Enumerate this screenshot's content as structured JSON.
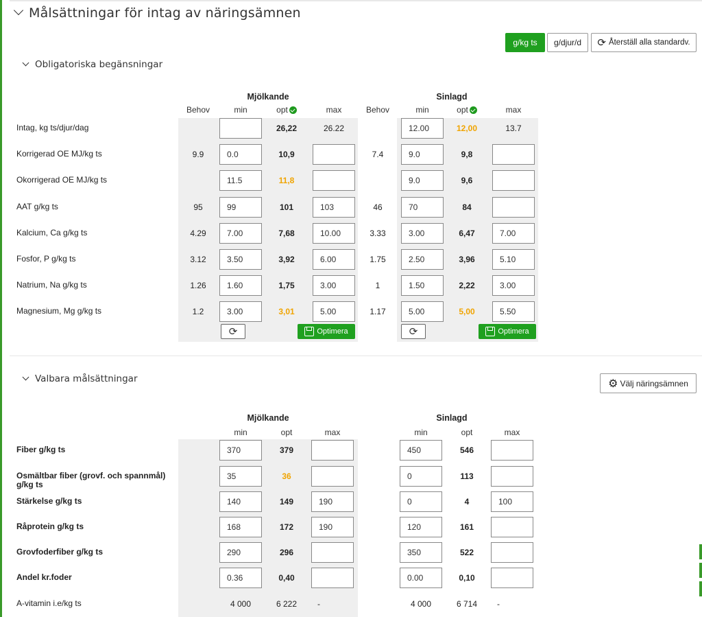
{
  "section_title": "Målsättningar för intag av näringsämnen",
  "units": {
    "gkgts": "g/kg ts",
    "gdjur": "g/djur/d",
    "reset_all": "Återställ alla standardv."
  },
  "mandatory": {
    "title": "Obligatoriska begänsningar",
    "groups": [
      "Mjölkande",
      "Sinlagd"
    ],
    "cols": {
      "behov": "Behov",
      "min": "min",
      "opt": "opt",
      "max": "max"
    },
    "rows": [
      {
        "label": "Intag, kg ts/djur/dag",
        "a": {
          "behov": "",
          "min": "",
          "opt": "26,22",
          "max": "26.22"
        },
        "b": {
          "behov": "",
          "min": "12.00",
          "opt": "12,00",
          "max": "13.7"
        }
      },
      {
        "label": "Korrigerad OE MJ/kg ts",
        "a": {
          "behov": "9.9",
          "min": "0.0",
          "opt": "10,9",
          "max": ""
        },
        "b": {
          "behov": "7.4",
          "min": "9.0",
          "opt": "9,8",
          "max": ""
        }
      },
      {
        "label": "Okorrigerad OE MJ/kg ts",
        "a": {
          "behov": "",
          "min": "11.5",
          "opt": "11,8",
          "max": ""
        },
        "b": {
          "behov": "",
          "min": "9.0",
          "opt": "9,6",
          "max": ""
        }
      },
      {
        "label": "AAT g/kg ts",
        "a": {
          "behov": "95",
          "min": "99",
          "opt": "101",
          "max": "103"
        },
        "b": {
          "behov": "46",
          "min": "70",
          "opt": "84",
          "max": ""
        }
      },
      {
        "label": "Kalcium, Ca g/kg ts",
        "a": {
          "behov": "4.29",
          "min": "7.00",
          "opt": "7,68",
          "max": "10.00"
        },
        "b": {
          "behov": "3.33",
          "min": "3.00",
          "opt": "6,47",
          "max": "7.00"
        }
      },
      {
        "label": "Fosfor, P g/kg ts",
        "a": {
          "behov": "3.12",
          "min": "3.50",
          "opt": "3,92",
          "max": "6.00"
        },
        "b": {
          "behov": "1.75",
          "min": "2.50",
          "opt": "3,96",
          "max": "5.10"
        }
      },
      {
        "label": "Natrium, Na g/kg ts",
        "a": {
          "behov": "1.26",
          "min": "1.60",
          "opt": "1,75",
          "max": "3.00"
        },
        "b": {
          "behov": "1",
          "min": "1.50",
          "opt": "2,22",
          "max": "3.00"
        }
      },
      {
        "label": "Magnesium, Mg g/kg ts",
        "a": {
          "behov": "1.2",
          "min": "3.00",
          "opt": "3,01",
          "max": "5.00"
        },
        "b": {
          "behov": "1.17",
          "min": "5.00",
          "opt": "5,00",
          "max": "5.50"
        }
      }
    ],
    "optimize": "Optimera"
  },
  "optional": {
    "title": "Valbara målsättningar",
    "choose": "Välj näringsämnen",
    "groups": [
      "Mjölkande",
      "Sinlagd"
    ],
    "cols": {
      "min": "min",
      "opt": "opt",
      "max": "max"
    },
    "rows": [
      {
        "label": "Fiber g/kg ts",
        "a": {
          "min": "370",
          "opt": "379",
          "max": ""
        },
        "b": {
          "min": "450",
          "opt": "546",
          "max": ""
        }
      },
      {
        "label": "Osmältbar fiber (grovf. och spannmål)",
        "label2": "g/kg ts",
        "a": {
          "min": "35",
          "opt": "36",
          "max": ""
        },
        "b": {
          "min": "0",
          "opt": "113",
          "max": ""
        }
      },
      {
        "label": "Stärkelse g/kg ts",
        "a": {
          "min": "140",
          "opt": "149",
          "max": "190"
        },
        "b": {
          "min": "0",
          "opt": "4",
          "max": "100"
        }
      },
      {
        "label": "Råprotein g/kg ts",
        "a": {
          "min": "168",
          "opt": "172",
          "max": "190"
        },
        "b": {
          "min": "120",
          "opt": "161",
          "max": ""
        }
      },
      {
        "label": "Grovfoderfiber g/kg ts",
        "a": {
          "min": "290",
          "opt": "296",
          "max": ""
        },
        "b": {
          "min": "350",
          "opt": "522",
          "max": ""
        }
      },
      {
        "label": "Andel kr.foder",
        "a": {
          "min": "0.36",
          "opt": "0,40",
          "max": ""
        },
        "b": {
          "min": "0.00",
          "opt": "0,10",
          "max": ""
        }
      },
      {
        "label": "A-vitamin i.e/kg ts",
        "a": {
          "min": "4 000",
          "opt": "6 222",
          "max": "-"
        },
        "b": {
          "min": "4 000",
          "opt": "6 714",
          "max": "-"
        }
      }
    ]
  }
}
